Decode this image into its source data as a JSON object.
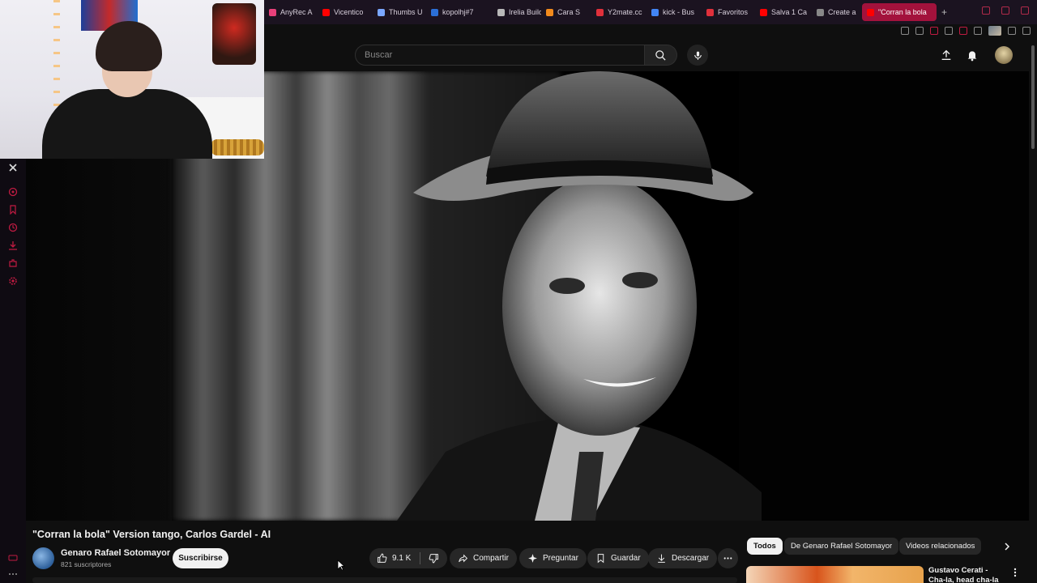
{
  "browser": {
    "tabs": [
      {
        "label": "AnyRec A",
        "color": "#e8407a"
      },
      {
        "label": "Vicentico",
        "color": "#ff0000"
      },
      {
        "label": "Thumbs U",
        "color": "#7aa7ff"
      },
      {
        "label": "kopolhj#7",
        "color": "#2b6fd6"
      },
      {
        "label": "Irelia Build",
        "color": "#b8b8b8"
      },
      {
        "label": "Cara S",
        "color": "#f28a1c"
      },
      {
        "label": "Y2mate.cc",
        "color": "#e0303b"
      },
      {
        "label": "kick - Bus",
        "color": "#4285f4"
      },
      {
        "label": "Favoritos",
        "color": "#e0303b"
      },
      {
        "label": "Salva 1 Ca",
        "color": "#ff0000"
      },
      {
        "label": "Create a",
        "color": "#888888"
      },
      {
        "label": "\"Corran la bola",
        "color": "#ff0000",
        "active": true
      }
    ],
    "new_tab": "+"
  },
  "youtube": {
    "search_placeholder": "Buscar",
    "video": {
      "title": "\"Corran la bola\" Version tango, Carlos Gardel - AI",
      "channel": "Genaro Rafael Sotomayor",
      "subscribers": "821 suscriptores",
      "subscribe_label": "Suscribirse",
      "likes": "9.1 K",
      "actions": {
        "share": "Compartir",
        "ask": "Preguntar",
        "save": "Guardar",
        "download": "Descargar"
      }
    },
    "chips": [
      "Todos",
      "De Genaro Rafael Sotomayor",
      "Videos relacionados"
    ],
    "recommendation": {
      "title": "Gustavo Cerati - Cha-la, head cha-la (IA)"
    }
  },
  "colors": {
    "accent": "#a3123c",
    "background": "#0f0f0f",
    "chip_bg": "#272727"
  }
}
